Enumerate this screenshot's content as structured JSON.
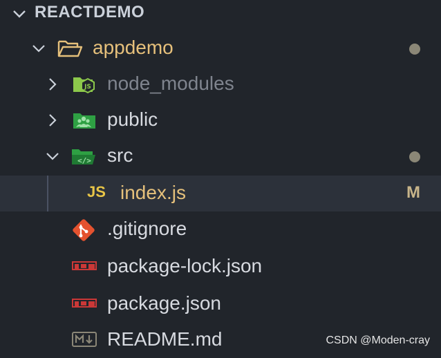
{
  "explorer": {
    "section_title": "REACTDEMO"
  },
  "tree": {
    "appdemo": {
      "label": "appdemo",
      "status": "dot"
    },
    "node_modules": {
      "label": "node_modules"
    },
    "public": {
      "label": "public"
    },
    "src": {
      "label": "src",
      "status": "dot"
    },
    "index_js": {
      "label": "index.js",
      "icon_text": "JS",
      "badge": "M"
    },
    "gitignore": {
      "label": ".gitignore"
    },
    "package_lock": {
      "label": "package-lock.json"
    },
    "package_json": {
      "label": "package.json"
    },
    "readme": {
      "label": "README.md"
    }
  },
  "watermark": {
    "text": "CSDN @Moden-cray"
  },
  "colors": {
    "background": "#21252b",
    "selected_row": "#2c313a",
    "folder_open_label": "#e6c07b",
    "modified_badge": "#c8b58a",
    "js_icon": "#e8c547",
    "git_icon": "#e4522f",
    "npm_icon": "#cb3837"
  }
}
